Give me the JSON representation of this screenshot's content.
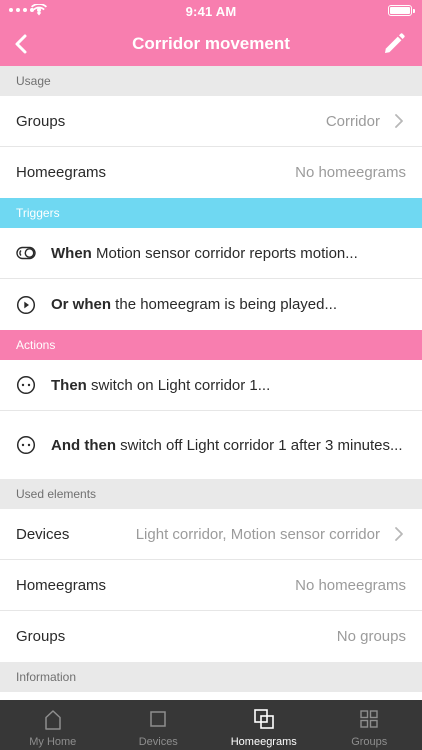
{
  "status": {
    "time": "9:41 AM"
  },
  "nav": {
    "title": "Corridor movement",
    "back_icon": "chevron-left-icon",
    "edit_icon": "pencil-icon"
  },
  "colors": {
    "accent": "#f87eaf",
    "triggers": "#6fd8f2",
    "tabbar": "#373737"
  },
  "usage": {
    "header": "Usage",
    "groups_label": "Groups",
    "groups_value": "Corridor",
    "homeegrams_label": "Homeegrams",
    "homeegrams_value": "No homeegrams"
  },
  "triggers": {
    "header": "Triggers",
    "items": [
      {
        "icon": "toggle-sensor-icon",
        "bold": "When",
        "text": " Motion sensor corridor reports motion..."
      },
      {
        "icon": "play-circle-icon",
        "bold": "Or when",
        "text": " the homeegram is being played..."
      }
    ]
  },
  "actions": {
    "header": "Actions",
    "items": [
      {
        "icon": "action-dots-icon",
        "bold": "Then",
        "text": " switch on Light corridor 1..."
      },
      {
        "icon": "action-dots-icon",
        "bold": "And then",
        "text": " switch off Light corridor 1 after 3 minutes..."
      }
    ]
  },
  "used_elements": {
    "header": "Used elements",
    "devices_label": "Devices",
    "devices_value": "Light corridor, Motion sensor corridor",
    "homeegrams_label": "Homeegrams",
    "homeegrams_value": "No homeegrams",
    "groups_label": "Groups",
    "groups_value": "No groups"
  },
  "information": {
    "header": "Information"
  },
  "tabbar": {
    "tabs": [
      {
        "label": "My Home",
        "icon": "house-icon",
        "active": false
      },
      {
        "label": "Devices",
        "icon": "device-square-icon",
        "active": false
      },
      {
        "label": "Homeegrams",
        "icon": "homeegram-icon",
        "active": true
      },
      {
        "label": "Groups",
        "icon": "groups-grid-icon",
        "active": false
      }
    ]
  }
}
